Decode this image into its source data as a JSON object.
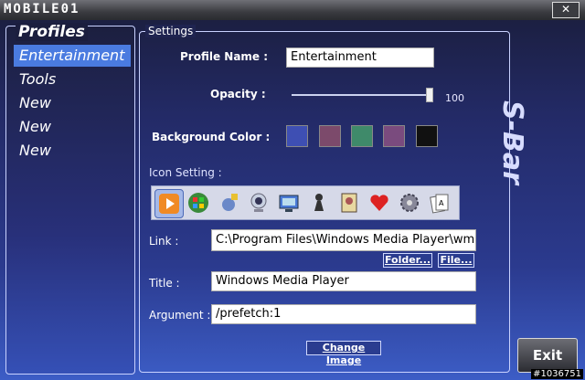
{
  "app": {
    "logo": "MOBILE01",
    "close": "✕"
  },
  "profiles": {
    "title": "Profiles",
    "items": [
      {
        "label": "Entertainment",
        "active": true
      },
      {
        "label": "Tools",
        "active": false
      },
      {
        "label": "New",
        "active": false
      },
      {
        "label": "New",
        "active": false
      },
      {
        "label": "New",
        "active": false
      }
    ]
  },
  "settings": {
    "title": "Settings",
    "profile_name_label": "Profile Name :",
    "profile_name_value": "Entertainment",
    "opacity_label": "Opacity :",
    "opacity_value": "100",
    "opacity_level": 1.0,
    "background_color_label": "Background Color :",
    "swatches": [
      "#3e4fb3",
      "#7c4a6b",
      "#3f8a6a",
      "#7a4b7e",
      "#111111"
    ],
    "icon_setting_label": "Icon Setting :",
    "icons": [
      "media-player-icon",
      "windows-icon",
      "satellite-icon",
      "webcam-icon",
      "network-icon",
      "chess-icon",
      "solitaire-icon",
      "hearts-icon",
      "gear-icon",
      "cards-icon"
    ],
    "link_label": "Link :",
    "link_value": "C:\\Program Files\\Windows Media Player\\wmp",
    "folder_button": "Folder...",
    "file_button": "File...",
    "title_label": "Title :",
    "title_value": "Windows Media Player",
    "argument_label": "Argument :",
    "argument_value": "/prefetch:1",
    "change_image_button": "Change Image"
  },
  "side_title": "S-Bar",
  "exit_button": "Exit",
  "watermark": "#1036751"
}
